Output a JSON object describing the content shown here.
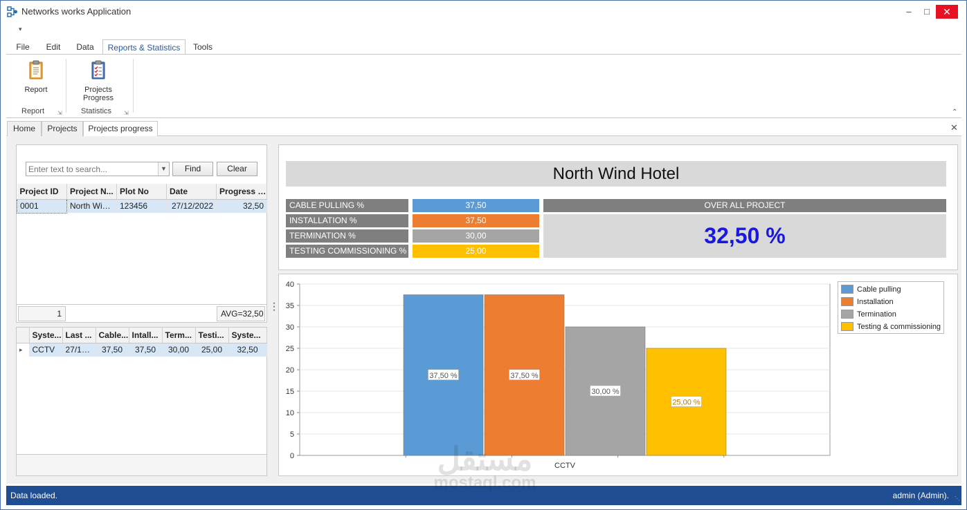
{
  "window": {
    "title": "Networks works Application",
    "controls": {
      "minimize": "–",
      "maximize": "□",
      "close": "✕"
    }
  },
  "ribbon": {
    "qat_glyph": "▾",
    "tabs": [
      {
        "label": "File"
      },
      {
        "label": "Edit"
      },
      {
        "label": "Data"
      },
      {
        "label": "Reports & Statistics"
      },
      {
        "label": "Tools"
      }
    ],
    "active_tab": "Reports & Statistics",
    "groups": [
      {
        "label": "Report",
        "buttons": [
          {
            "label": "Report",
            "icon": "clipboard-report-icon"
          }
        ]
      },
      {
        "label": "Statistics",
        "buttons": [
          {
            "label_line1": "Projects",
            "label_line2": "Progress",
            "icon": "clipboard-checklist-icon"
          }
        ]
      }
    ]
  },
  "doc_tabs": [
    {
      "label": "Home"
    },
    {
      "label": "Projects"
    },
    {
      "label": "Projects progress"
    }
  ],
  "search": {
    "placeholder": "Enter text to search...",
    "find_label": "Find",
    "clear_label": "Clear"
  },
  "projects_grid": {
    "columns": [
      "Project ID",
      "Project N...",
      "Plot No",
      "Date",
      "Progress (..."
    ],
    "rows": [
      {
        "id": "0001",
        "name": "North Win...",
        "plot": "123456",
        "date": "27/12/2022",
        "progress": "32,50"
      }
    ],
    "footer_count": "1",
    "footer_avg": "AVG=32,50"
  },
  "systems_grid": {
    "columns": [
      "Syste...",
      "Last ...",
      "Cable...",
      "Intall...",
      "Term...",
      "Testi...",
      "Syste..."
    ],
    "rows": [
      {
        "indicator": "▸",
        "system": "CCTV",
        "last": "27/12...",
        "cable": "37,50",
        "install": "37,50",
        "term": "30,00",
        "testing": "25,00",
        "sys": "32,50"
      }
    ]
  },
  "summary": {
    "project_name": "North Wind Hotel",
    "metrics": [
      {
        "label": "CABLE PULLING %",
        "value": "37,50",
        "color": "#5b9bd5"
      },
      {
        "label": "INSTALLATION %",
        "value": "37,50",
        "color": "#ed7d31"
      },
      {
        "label": "TERMINATION %",
        "value": "30,00",
        "color": "#a5a5a5"
      },
      {
        "label": "TESTING COMMISSIONING  %",
        "value": "25,00",
        "color": "#ffc000"
      }
    ],
    "overall_label": "OVER ALL PROJECT",
    "overall_value": "32,50 %"
  },
  "chart_data": {
    "type": "bar",
    "categories": [
      "CCTV"
    ],
    "series": [
      {
        "name": "Cable pulling",
        "values": [
          37.5
        ],
        "label": "37,50 %",
        "color": "#5b9bd5"
      },
      {
        "name": "Installation",
        "values": [
          37.5
        ],
        "label": "37,50 %",
        "color": "#ed7d31"
      },
      {
        "name": "Termination",
        "values": [
          30.0
        ],
        "label": "30,00 %",
        "color": "#a5a5a5"
      },
      {
        "name": "Testing & commissioning",
        "values": [
          25.0
        ],
        "label": "25,00 %",
        "color": "#ffc000"
      }
    ],
    "ylim": [
      0,
      40
    ],
    "yticks": [
      0,
      5,
      10,
      15,
      20,
      25,
      30,
      35,
      40
    ],
    "grid": true,
    "legend": "right",
    "title": "",
    "xlabel": "",
    "ylabel": ""
  },
  "status": {
    "left": "Data loaded.",
    "right": "admin (Admin)."
  },
  "watermark": {
    "arabic": "مستقل",
    "latin": "mostaql.com"
  }
}
